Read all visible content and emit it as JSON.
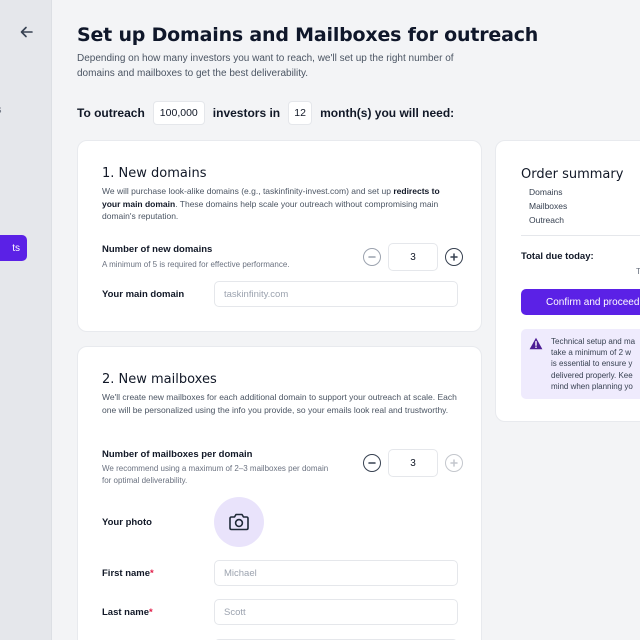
{
  "sidebar": {
    "fragment_a": "s",
    "active_item_fragment": "ts"
  },
  "header": {
    "title": "Set up Domains and Mailboxes for outreach",
    "subtitle": "Depending on how many investors you want to reach, we'll set up the right number of domains and mailboxes to get the best deliverability."
  },
  "outreach": {
    "prefix": "To outreach",
    "investors_value": "100,000",
    "middle": "investors in",
    "months_value": "12",
    "suffix": "month(s) you will need:"
  },
  "domains": {
    "title": "1. New domains",
    "desc_start": "We will purchase look-alike domains (e.g., taskinfinity-invest.com) and set up ",
    "desc_bold": "redirects to your main domain",
    "desc_end": ". These domains help scale your outreach without compromising main domain's reputation.",
    "count_label": "Number of new domains",
    "count_hint": "A minimum of 5 is required for effective performance.",
    "count_value": "3",
    "main_domain_label": "Your main domain",
    "main_domain_value": "taskinfinity.com"
  },
  "mailboxes": {
    "title": "2. New mailboxes",
    "desc": "We'll create new mailboxes for each additional domain to support your outreach at scale. Each one will be personalized using the info you provide, so your emails look real and trustworthy.",
    "count_label": "Number of mailboxes per domain",
    "count_hint": "We recommend using a maximum of 2–3 mailboxes per domain for optimal deliverability.",
    "count_value": "3",
    "photo_label": "Your photo",
    "first_name_label": "First name",
    "first_name_value": "Michael",
    "last_name_label": "Last name",
    "last_name_value": "Scott",
    "required_mark": "*"
  },
  "order": {
    "title": "Order summary",
    "lines": [
      "Domains",
      "Mailboxes",
      "Outreach"
    ],
    "total_label": "Total due today:",
    "total_fragment": "Th",
    "confirm_label": "Confirm and proceed",
    "alert_text": "Technical setup and ma\ntake a minimum of 2 w\nis essential to ensure y\ndelivered properly. Kee\nmind when planning yo"
  },
  "colors": {
    "accent": "#5b21e6",
    "alert_bg": "#efebfd",
    "photo_bg": "#e9e3fb"
  },
  "icons": {
    "back": "arrow-left-icon",
    "minus": "minus-circle-icon",
    "plus": "plus-circle-icon",
    "camera": "camera-icon",
    "warning": "warning-triangle-icon"
  }
}
